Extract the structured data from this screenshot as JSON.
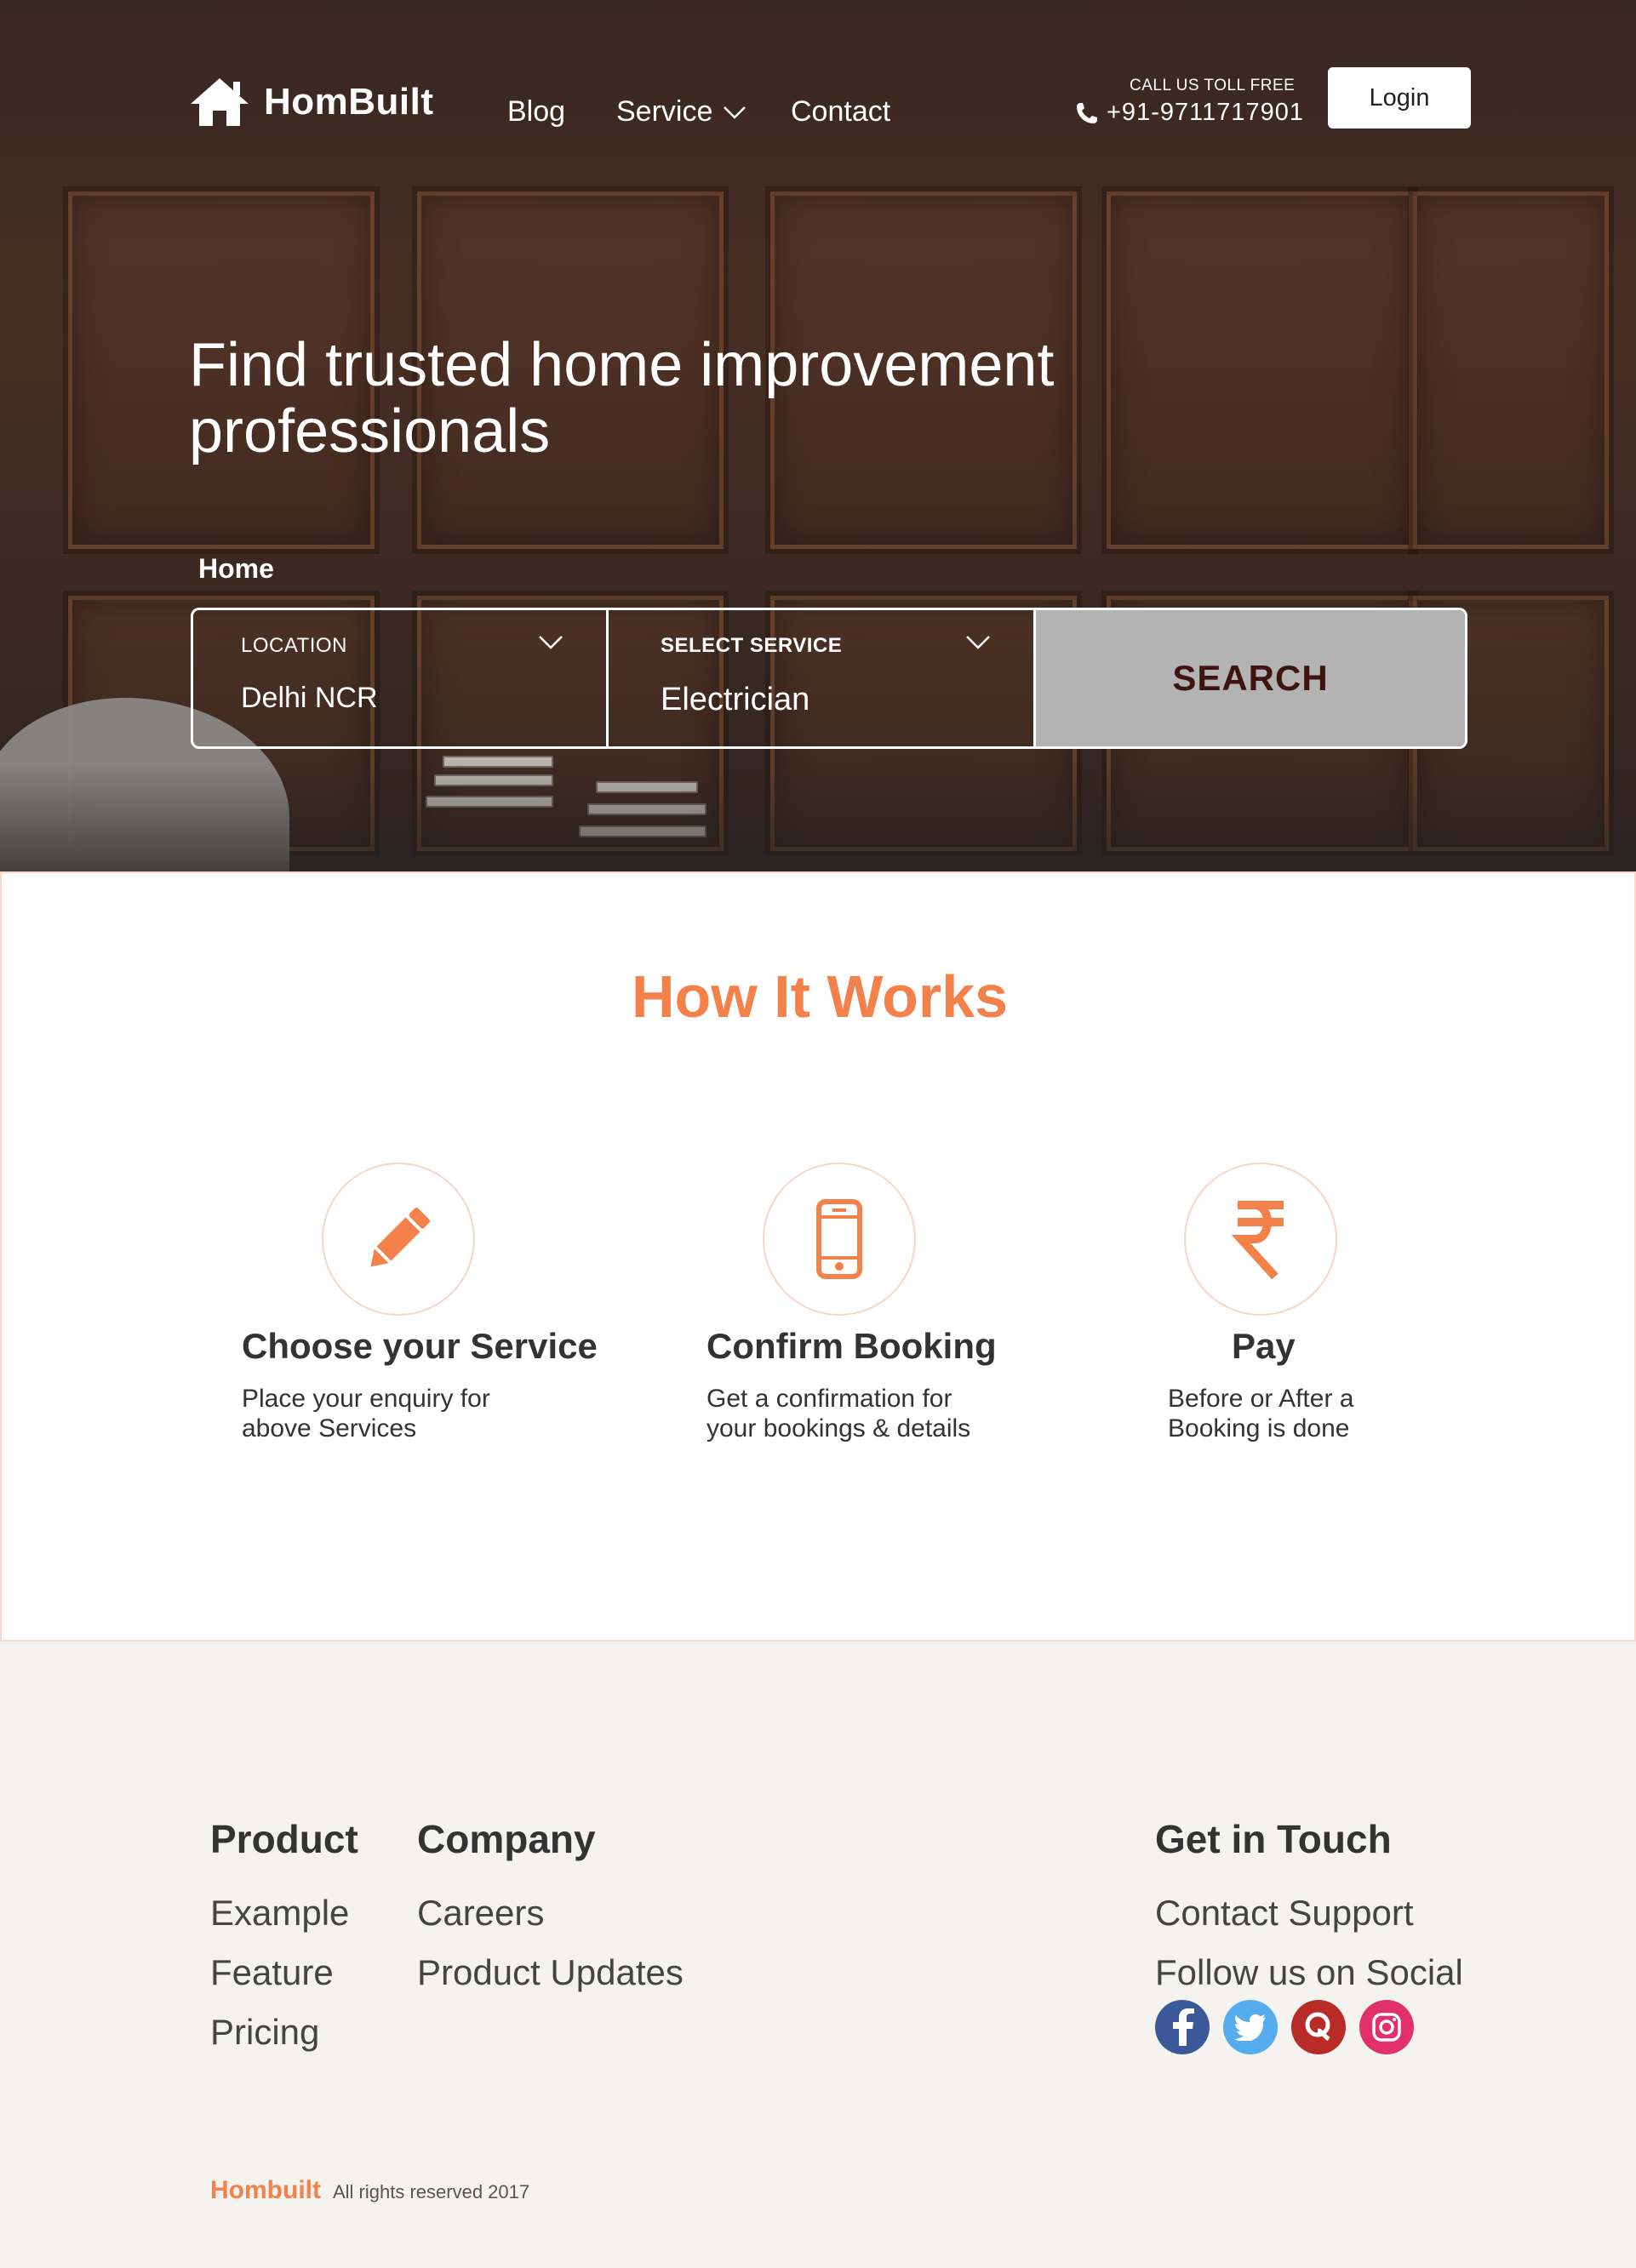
{
  "header": {
    "logo_text": "HomBuilt",
    "nav": {
      "blog": "Blog",
      "service": "Service",
      "contact": "Contact"
    },
    "toll_free_label": "CALL US TOLL FREE",
    "phone": "+91-9711717901",
    "login_label": "Login"
  },
  "hero": {
    "title": "Find trusted home improvement professionals",
    "breadcrumb": "Home"
  },
  "search": {
    "location_label": "LOCATION",
    "location_value": "Delhi NCR",
    "service_label": "SELECT SERVICE",
    "service_value": "Electrician",
    "button_label": "SEARCH"
  },
  "how_it_works": {
    "title": "How It Works",
    "steps": [
      {
        "icon": "pencil-icon",
        "title": "Choose your Service",
        "desc": "Place your enquiry for\n above Services"
      },
      {
        "icon": "phone-icon",
        "title": "Confirm Booking",
        "desc": "Get a confirmation for\nyour bookings & details"
      },
      {
        "icon": "rupee-icon",
        "title": "Pay",
        "desc": "Before or After a\nBooking is done"
      }
    ]
  },
  "footer": {
    "product": {
      "heading": "Product",
      "links": [
        "Example",
        "Feature",
        "Pricing"
      ]
    },
    "company": {
      "heading": "Company",
      "links": [
        "Careers",
        "Product Updates"
      ]
    },
    "touch": {
      "heading": "Get in Touch",
      "links": [
        "Contact Support",
        "Follow us on Social"
      ]
    },
    "socials": [
      "facebook-icon",
      "twitter-icon",
      "quora-icon",
      "instagram-icon"
    ],
    "copyright_brand": "Hombuilt",
    "copyright_text": "All rights reserved 2017"
  },
  "colors": {
    "accent": "#f4814a",
    "search_button": "#b3b3b3",
    "search_text": "#3d1410",
    "footer_bg": "#f5f3ef",
    "facebook": "#3b5998",
    "twitter": "#55acee",
    "quora": "#b92b27",
    "instagram": "#e1306c"
  }
}
